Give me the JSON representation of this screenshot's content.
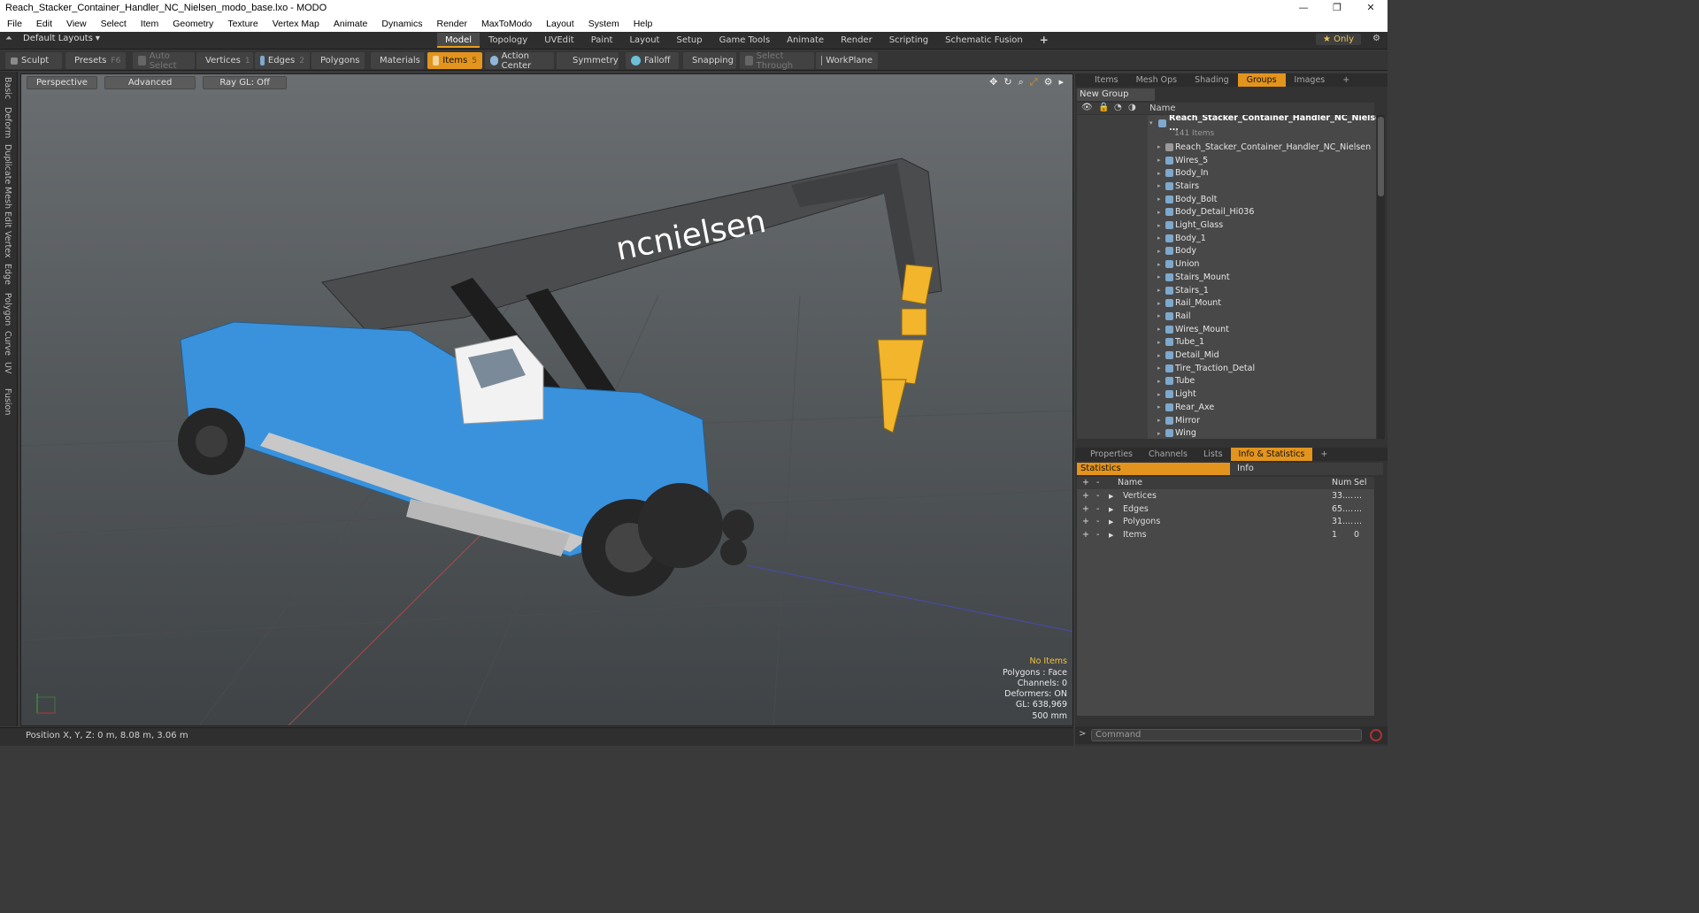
{
  "window": {
    "title": "Reach_Stacker_Container_Handler_NC_Nielsen_modo_base.lxo - MODO",
    "controls": [
      "—",
      "❐",
      "✕"
    ]
  },
  "menu": [
    "File",
    "Edit",
    "View",
    "Select",
    "Item",
    "Geometry",
    "Texture",
    "Vertex Map",
    "Animate",
    "Dynamics",
    "Render",
    "MaxToModo",
    "Layout",
    "System",
    "Help"
  ],
  "layoutbar": {
    "layouts_label": "Default Layouts",
    "tabs": [
      "Model",
      "Topology",
      "UVEdit",
      "Paint",
      "Layout",
      "Setup",
      "Game Tools",
      "Animate",
      "Render",
      "Scripting",
      "Schematic Fusion"
    ],
    "active_tab": "Model",
    "add": "+",
    "only_label": "Only"
  },
  "toolbar": {
    "sculpt": "Sculpt",
    "presets": "Presets",
    "presets_key": "F6",
    "auto_select": "Auto Select",
    "vertices": "Vertices",
    "vertices_key": "1",
    "edges": "Edges",
    "edges_key": "2",
    "polygons": "Polygons",
    "materials": "Materials",
    "items": "Items",
    "items_key": "5",
    "action_center": "Action Center",
    "symmetry": "Symmetry",
    "falloff": "Falloff",
    "snapping": "Snapping",
    "select_through": "Select Through",
    "workplane": "WorkPlane"
  },
  "left_strip": [
    "Basic",
    "Deform",
    "Duplicate",
    "Mesh Edit",
    "Vertex",
    "Edge",
    "Polygon",
    "Curve",
    "UV",
    "Fusion"
  ],
  "viewport": {
    "view_mode": "Perspective",
    "advanced": "Advanced",
    "raygl": "Ray GL: Off",
    "logo_text": "ncnielsen",
    "info": {
      "no_items": "No Items",
      "polygons": "Polygons : Face",
      "channels": "Channels: 0",
      "deformers": "Deformers: ON",
      "gl": "GL: 638,969",
      "scale": "500 mm"
    },
    "colors": {
      "body": "#3a92dc",
      "boom": "#4b4c4e",
      "hook": "#f2b52b",
      "highlight": "#e79c1c"
    }
  },
  "status": {
    "position": "Position X, Y, Z:  0 m, 8.08 m, 3.06 m"
  },
  "items_panel": {
    "tabs": [
      "Items",
      "Mesh Ops",
      "Shading",
      "Groups",
      "Images",
      "+"
    ],
    "active_tab": "Groups",
    "new_group": "New Group",
    "name_header": "Name",
    "root_name": "Reach_Stacker_Container_Handler_NC_Nielsen ...",
    "root_count": "141 Items",
    "items": [
      "Reach_Stacker_Container_Handler_NC_Nielsen",
      "Wires_5",
      "Body_In",
      "Stairs",
      "Body_Bolt",
      "Body_Detail_Hi036",
      "Light_Glass",
      "Body_1",
      "Body",
      "Union",
      "Stairs_Mount",
      "Stairs_1",
      "Rail_Mount",
      "Rail",
      "Wires_Mount",
      "Tube_1",
      "Detail_Mid",
      "Tire_Traction_Detal",
      "Tube",
      "Light",
      "Rear_Axe",
      "Mirror",
      "Wing"
    ]
  },
  "stats_panel": {
    "tabs": [
      "Properties",
      "Channels",
      "Lists",
      "Info & Statistics",
      "+"
    ],
    "active_tab": "Info & Statistics",
    "sub_statistics": "Statistics",
    "sub_info": "Info",
    "headers": {
      "name": "Name",
      "num": "Num",
      "sel": "Sel"
    },
    "rows": [
      {
        "plus": "+",
        "minus": "-",
        "name": "Vertices",
        "num": "33....",
        "sel": "..."
      },
      {
        "plus": "+",
        "minus": "-",
        "name": "Edges",
        "num": "65....",
        "sel": "..."
      },
      {
        "plus": "+",
        "minus": "-",
        "name": "Polygons",
        "num": "31....",
        "sel": "..."
      },
      {
        "plus": "+",
        "minus": "-",
        "name": "Items",
        "num": "1",
        "sel": "0"
      }
    ]
  },
  "command": {
    "prompt": ">",
    "placeholder": "Command"
  }
}
